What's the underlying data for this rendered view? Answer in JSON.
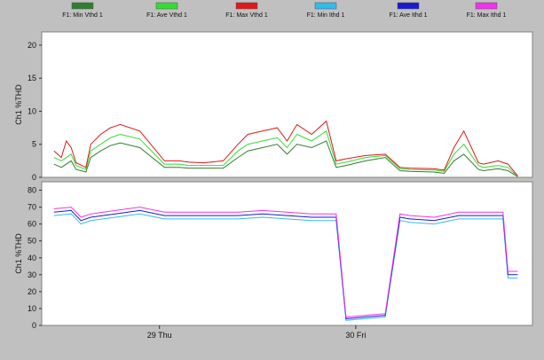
{
  "legend": [
    {
      "label": "F1: Min Vthd 1",
      "color": "#2f7f2f"
    },
    {
      "label": "F1: Ave Vthd 1",
      "color": "#33dd33"
    },
    {
      "label": "F1: Max Vthd 1",
      "color": "#e01818"
    },
    {
      "label": "F1: Min Ithd 1",
      "color": "#33bbee"
    },
    {
      "label": "F1: Ave Ithd 1",
      "color": "#1a1acc"
    },
    {
      "label": "F1: Max Ithd 1",
      "color": "#ee33ee"
    }
  ],
  "chart_data": [
    {
      "type": "line",
      "ylabel": "Ch1 %THD",
      "ylim": [
        0,
        22
      ],
      "yticks": [
        0,
        5,
        10,
        15,
        20
      ],
      "grid": false,
      "legend_position": "top",
      "xlim": [
        0,
        1
      ],
      "series": [
        {
          "name": "F1: Min Vthd 1",
          "color": "#2f7f2f",
          "x": [
            0.025,
            0.04,
            0.06,
            0.07,
            0.09,
            0.1,
            0.12,
            0.14,
            0.16,
            0.2,
            0.25,
            0.28,
            0.3,
            0.33,
            0.37,
            0.4,
            0.42,
            0.45,
            0.48,
            0.5,
            0.52,
            0.55,
            0.58,
            0.6,
            0.62,
            0.66,
            0.7,
            0.73,
            0.75,
            0.8,
            0.81,
            0.82,
            0.84,
            0.86,
            0.89,
            0.9,
            0.93,
            0.95,
            0.97
          ],
          "y": [
            2,
            1.5,
            2.5,
            1.2,
            0.8,
            3,
            4,
            4.8,
            5.2,
            4.5,
            1.5,
            1.5,
            1.4,
            1.4,
            1.4,
            3,
            4,
            4.5,
            5,
            3.5,
            5,
            4.5,
            5.5,
            1.5,
            1.8,
            2.5,
            3,
            1,
            0.9,
            0.8,
            0.7,
            0.6,
            2.5,
            3.5,
            1.2,
            1,
            1.3,
            1,
            0.1
          ]
        },
        {
          "name": "F1: Ave Vthd 1",
          "color": "#33dd33",
          "x": [
            0.025,
            0.04,
            0.06,
            0.07,
            0.09,
            0.1,
            0.12,
            0.14,
            0.16,
            0.2,
            0.25,
            0.28,
            0.3,
            0.33,
            0.37,
            0.4,
            0.42,
            0.45,
            0.48,
            0.5,
            0.52,
            0.55,
            0.58,
            0.6,
            0.62,
            0.66,
            0.7,
            0.73,
            0.75,
            0.8,
            0.81,
            0.82,
            0.84,
            0.86,
            0.89,
            0.9,
            0.93,
            0.95,
            0.97
          ],
          "y": [
            3,
            2.5,
            3.5,
            1.8,
            1.2,
            4,
            5,
            6,
            6.5,
            5.8,
            2,
            2,
            1.8,
            1.8,
            1.8,
            4,
            5,
            5.5,
            6,
            4.5,
            6.5,
            5.5,
            7,
            2,
            2.3,
            3,
            3.3,
            1.3,
            1.2,
            1.1,
            1,
            0.9,
            3.5,
            5,
            1.8,
            1.5,
            1.8,
            1.5,
            0.1
          ]
        },
        {
          "name": "F1: Max Vthd 1",
          "color": "#e01818",
          "x": [
            0.025,
            0.04,
            0.05,
            0.06,
            0.07,
            0.09,
            0.1,
            0.12,
            0.14,
            0.16,
            0.2,
            0.25,
            0.28,
            0.3,
            0.33,
            0.37,
            0.4,
            0.42,
            0.45,
            0.48,
            0.5,
            0.52,
            0.55,
            0.58,
            0.6,
            0.62,
            0.66,
            0.7,
            0.73,
            0.75,
            0.8,
            0.81,
            0.82,
            0.84,
            0.86,
            0.89,
            0.9,
            0.93,
            0.95,
            0.97
          ],
          "y": [
            4,
            3,
            5.5,
            4.5,
            2.2,
            1.5,
            5,
            6.5,
            7.5,
            8,
            7,
            2.5,
            2.5,
            2.3,
            2.2,
            2.5,
            5,
            6.5,
            7,
            7.5,
            5.5,
            8,
            6.5,
            8.5,
            2.5,
            2.8,
            3.3,
            3.5,
            1.5,
            1.4,
            1.3,
            1.2,
            1.1,
            4.5,
            7,
            2.2,
            2,
            2.5,
            2,
            0.2
          ]
        }
      ]
    },
    {
      "type": "line",
      "ylabel": "Ch1 %THD",
      "ylim": [
        0,
        85
      ],
      "yticks": [
        0,
        10,
        20,
        30,
        40,
        50,
        60,
        70,
        80
      ],
      "xticks": [
        "29 Thu",
        "30 Fri"
      ],
      "grid": false,
      "xlim": [
        0,
        1
      ],
      "series": [
        {
          "name": "F1: Min Ithd 1",
          "color": "#33bbee",
          "x": [
            0.025,
            0.06,
            0.08,
            0.1,
            0.15,
            0.2,
            0.25,
            0.3,
            0.35,
            0.4,
            0.45,
            0.5,
            0.55,
            0.6,
            0.62,
            0.66,
            0.7,
            0.73,
            0.75,
            0.8,
            0.85,
            0.9,
            0.94,
            0.95,
            0.97
          ],
          "y": [
            65,
            66,
            60,
            62,
            64,
            66,
            63,
            63,
            63,
            63,
            64,
            63,
            62,
            62,
            3,
            4,
            5,
            62,
            61,
            60,
            63,
            63,
            63,
            28,
            28
          ]
        },
        {
          "name": "F1: Ave Ithd 1",
          "color": "#1a1acc",
          "x": [
            0.025,
            0.06,
            0.08,
            0.1,
            0.15,
            0.2,
            0.25,
            0.3,
            0.35,
            0.4,
            0.45,
            0.5,
            0.55,
            0.6,
            0.62,
            0.66,
            0.7,
            0.73,
            0.75,
            0.8,
            0.85,
            0.9,
            0.94,
            0.95,
            0.97
          ],
          "y": [
            67,
            68,
            62,
            64,
            66,
            68,
            65,
            65,
            65,
            65,
            66,
            65,
            64,
            64,
            4,
            5,
            6,
            64,
            63,
            62,
            65,
            65,
            65,
            30,
            30
          ]
        },
        {
          "name": "F1: Max Ithd 1",
          "color": "#ee33ee",
          "x": [
            0.025,
            0.06,
            0.08,
            0.1,
            0.15,
            0.2,
            0.25,
            0.3,
            0.35,
            0.4,
            0.45,
            0.5,
            0.55,
            0.6,
            0.62,
            0.66,
            0.7,
            0.73,
            0.75,
            0.8,
            0.85,
            0.9,
            0.94,
            0.95,
            0.97
          ],
          "y": [
            69,
            70,
            64,
            66,
            68,
            70,
            67,
            67,
            67,
            67,
            68,
            67,
            66,
            66,
            5,
            6,
            7,
            66,
            65,
            64,
            67,
            67,
            67,
            32,
            32
          ]
        }
      ]
    }
  ]
}
